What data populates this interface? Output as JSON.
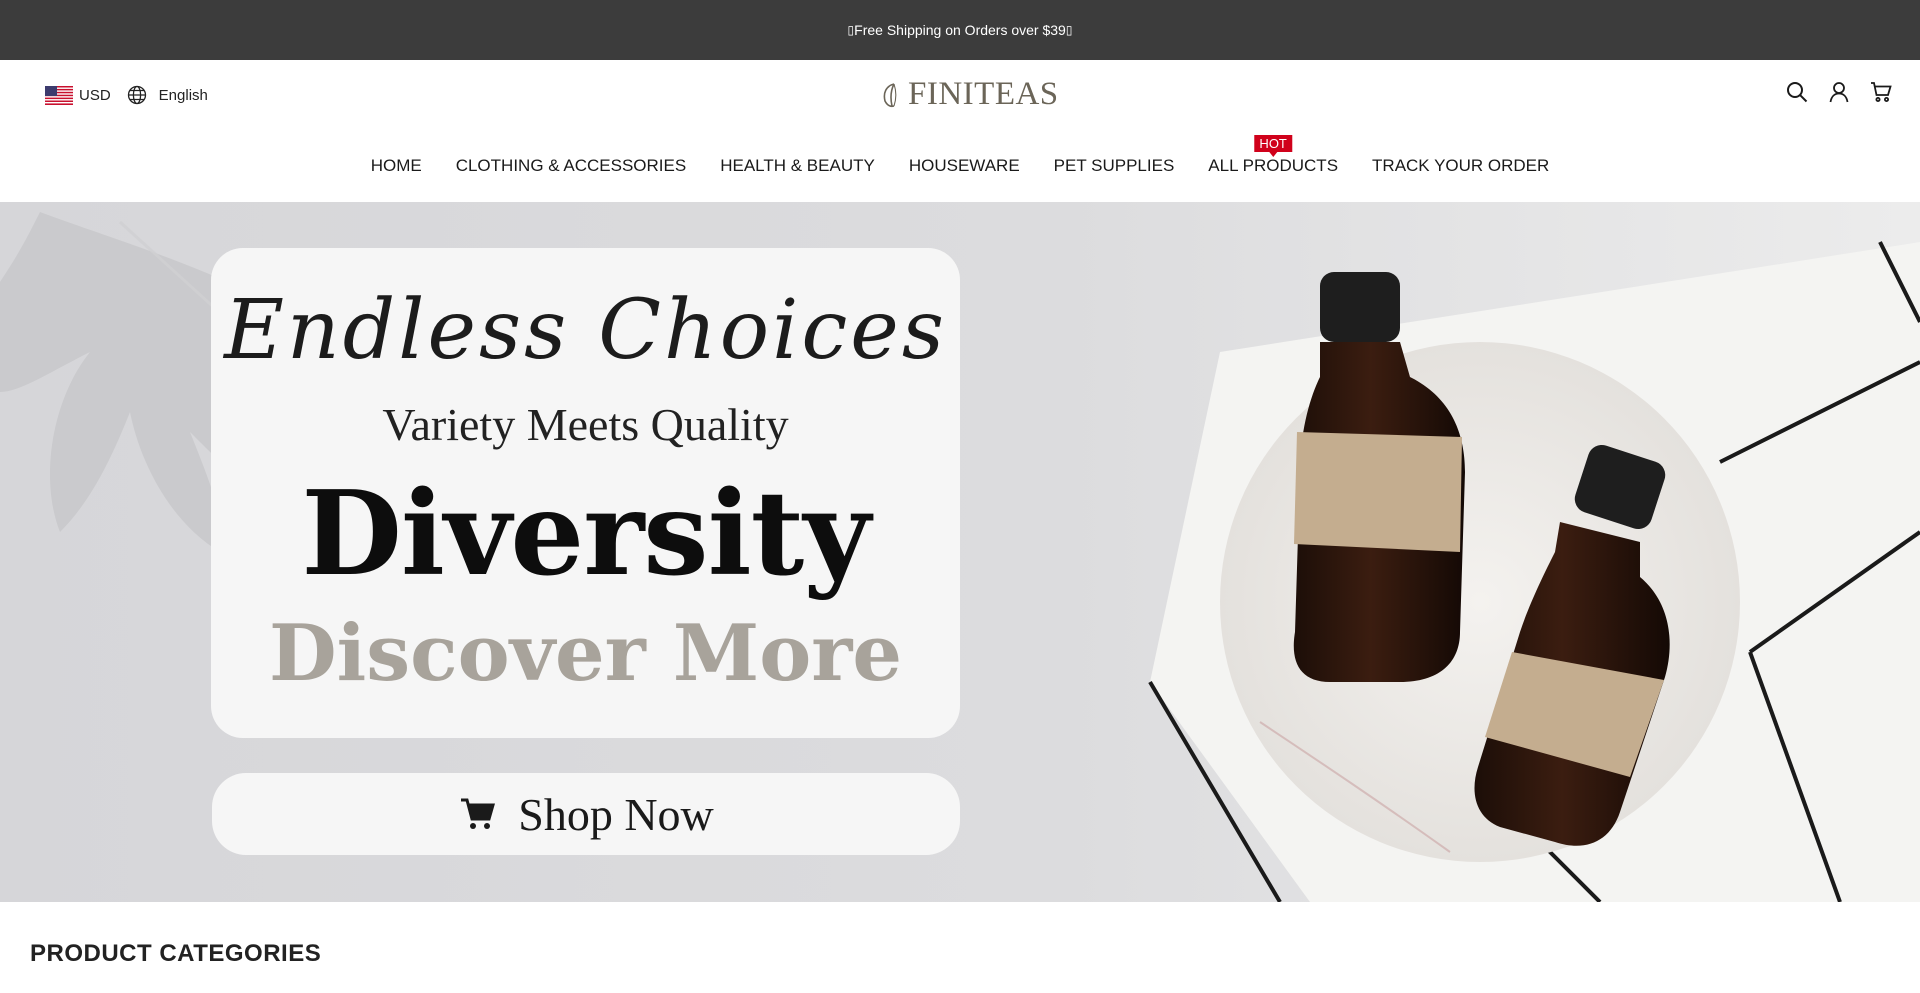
{
  "announcement": {
    "text": "Free Shipping on Orders over $39",
    "glyph": "▯"
  },
  "header": {
    "currency": "USD",
    "language": "English",
    "logo_text": "FINITEAS",
    "icons": [
      "search-icon",
      "account-icon",
      "cart-icon"
    ]
  },
  "nav": {
    "items": [
      {
        "label": "HOME"
      },
      {
        "label": "CLOTHING & ACCESSORIES"
      },
      {
        "label": "HEALTH & BEAUTY"
      },
      {
        "label": "HOUSEWARE"
      },
      {
        "label": "PET SUPPLIES"
      },
      {
        "label": "ALL PRODUCTS",
        "badge": "HOT"
      },
      {
        "label": "TRACK YOUR ORDER"
      }
    ]
  },
  "hero": {
    "script": "Endless Choices",
    "tagline": "Variety Meets Quality",
    "headline": "Diversity",
    "subheadline": "Discover More",
    "cta": "Shop Now"
  },
  "sections": {
    "product_categories": "PRODUCT CATEGORIES"
  },
  "colors": {
    "announcement_bg": "#3c3c3c",
    "badge_red": "#d0011b",
    "logo": "#6b6558",
    "discover_gray": "#a8a39b"
  }
}
